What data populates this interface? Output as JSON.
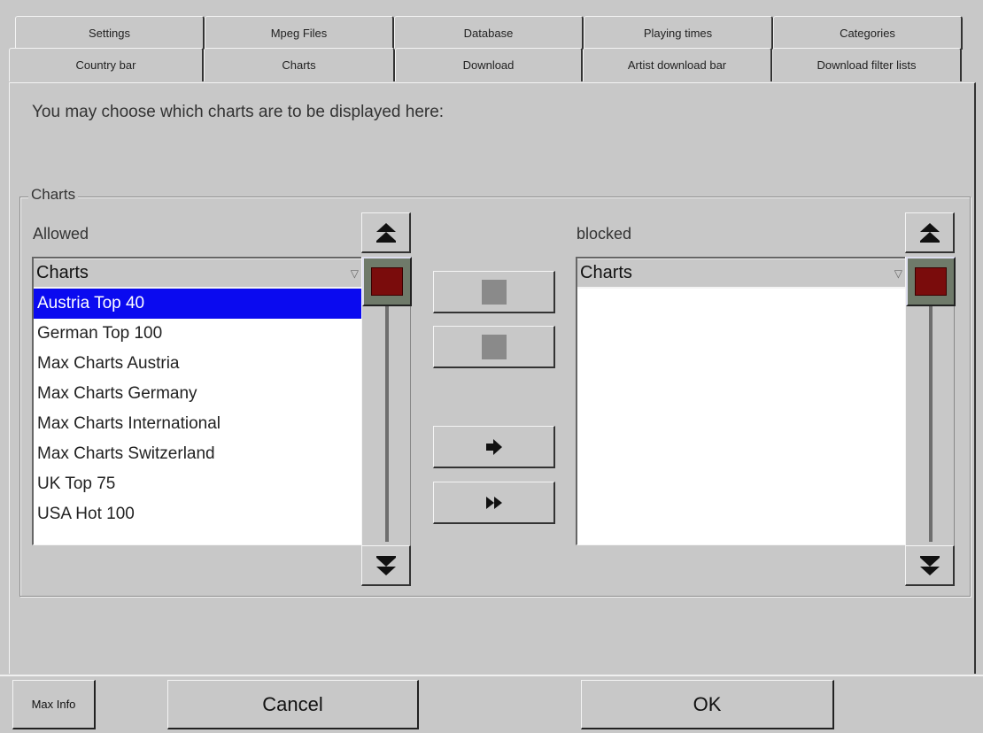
{
  "tabs": {
    "row1": [
      "Settings",
      "Mpeg Files",
      "Database",
      "Playing times",
      "Categories"
    ],
    "row2": [
      "Country bar",
      "Charts",
      "Download",
      "Artist download bar",
      "Download filter lists"
    ],
    "active": "Charts"
  },
  "prompt": "You may choose which charts are to be displayed here:",
  "group_title": "Charts",
  "allowed": {
    "label": "Allowed",
    "header": "Charts",
    "items": [
      "Austria Top 40",
      "German Top 100",
      "Max Charts Austria",
      "Max Charts Germany",
      "Max Charts International",
      "Max Charts Switzerland",
      "UK Top 75",
      "USA Hot 100"
    ],
    "selected_index": 0
  },
  "blocked": {
    "label": "blocked",
    "header": "Charts",
    "items": []
  },
  "icons": {
    "scroll_top": "double-up-arrow-icon",
    "scroll_bottom": "double-down-arrow-icon",
    "move_right": "right-arrow-icon",
    "move_all_right": "double-right-arrow-icon",
    "sort_indicator": "triangle-down-icon"
  },
  "buttons": {
    "max_info": "Max Info",
    "cancel": "Cancel",
    "ok": "OK"
  },
  "colors": {
    "background": "#c8c8c8",
    "selection": "#0a0af0",
    "thumb": "#7a0c0c"
  }
}
